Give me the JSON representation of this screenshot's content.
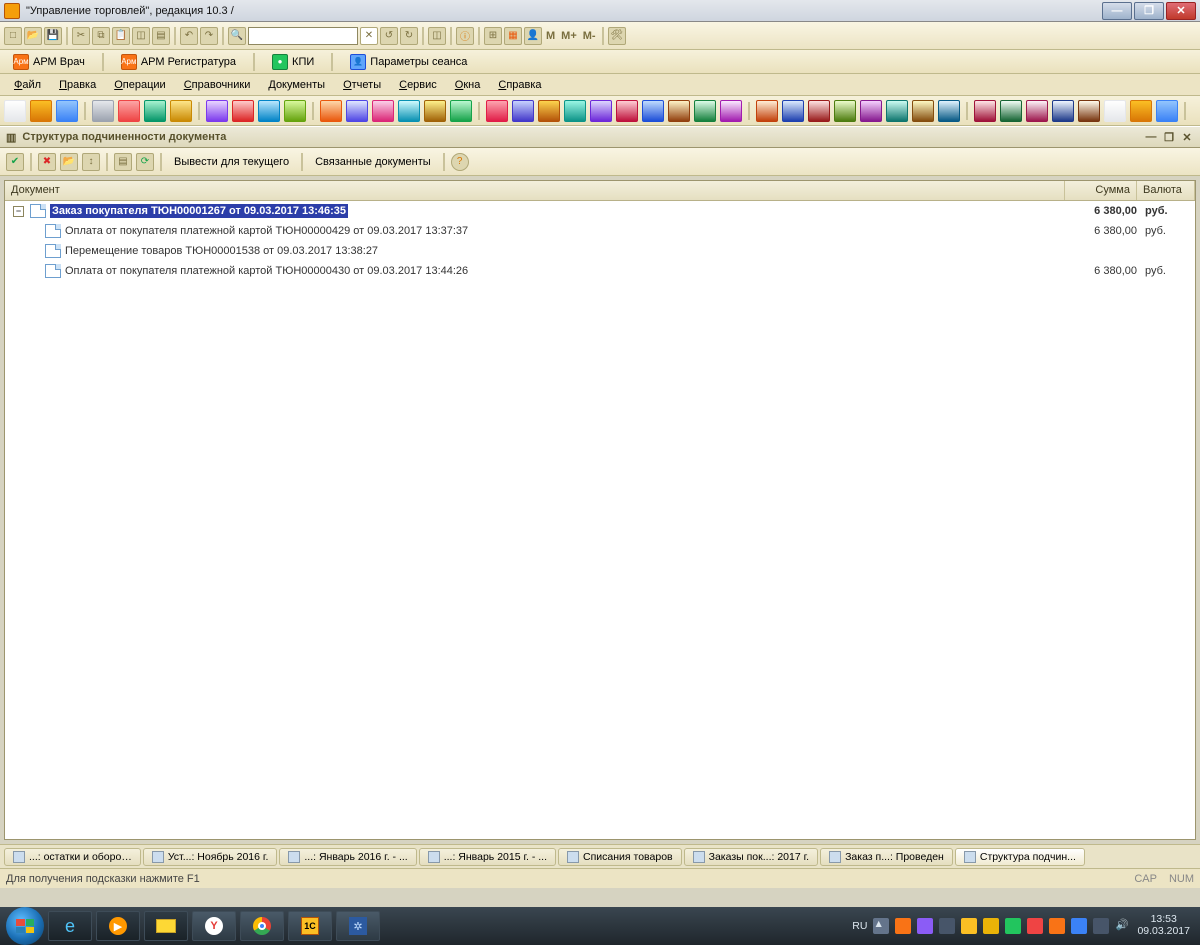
{
  "title": "\"Управление торговлей\", редакция 10.3 /",
  "arm": {
    "doctor": "АРМ Врач",
    "reg": "АРМ Регистратура",
    "kpi": "КПИ",
    "params": "Параметры сеанса"
  },
  "memory": {
    "m": "M",
    "mplus": "M+",
    "mminus": "M-"
  },
  "menu": [
    "Файл",
    "Правка",
    "Операции",
    "Справочники",
    "Документы",
    "Отчеты",
    "Сервис",
    "Окна",
    "Справка"
  ],
  "panel": {
    "title": "Структура подчиненности документа",
    "toolbar": {
      "output_current": "Вывести для текущего",
      "related": "Связанные документы"
    },
    "columns": {
      "doc": "Документ",
      "sum": "Сумма",
      "currency": "Валюта"
    },
    "rows": [
      {
        "indent": 0,
        "selected": true,
        "text": "Заказ покупателя ТЮН00001267 от 09.03.2017 13:46:35",
        "sum": "6 380,00",
        "currency": "руб."
      },
      {
        "indent": 1,
        "selected": false,
        "text": "Оплата от покупателя платежной картой ТЮН00000429 от 09.03.2017 13:37:37",
        "sum": "6 380,00",
        "currency": "руб."
      },
      {
        "indent": 1,
        "selected": false,
        "text": "Перемещение товаров ТЮН00001538 от 09.03.2017 13:38:27",
        "sum": "",
        "currency": ""
      },
      {
        "indent": 1,
        "selected": false,
        "text": "Оплата от покупателя платежной картой ТЮН00000430 от 09.03.2017 13:44:26",
        "sum": "6 380,00",
        "currency": "руб."
      }
    ]
  },
  "mdi_tabs": [
    "...: остатки и оборо…",
    "Уст...: Ноябрь 2016 г.",
    "...: Январь 2016 г. - ...",
    "...: Январь 2015 г. - ...",
    "Списания товаров",
    "Заказы пок...: 2017 г.",
    "Заказ п...: Проведен",
    "Структура подчин..."
  ],
  "statusbar": {
    "hint": "Для получения подсказки нажмите F1",
    "cap": "CAP",
    "num": "NUM"
  },
  "taskbar": {
    "lang": "RU",
    "time": "13:53",
    "date": "09.03.2017"
  },
  "icon_colors": [
    [
      "#fff",
      "#e5e7eb"
    ],
    [
      "#fbbf24",
      "#d97706"
    ],
    [
      "#93c5fd",
      "#3b82f6"
    ],
    [
      "#e5e7eb",
      "#9ca3af"
    ],
    [
      "#fca5a5",
      "#ef4444"
    ],
    [
      "#a7f3d0",
      "#059669"
    ],
    [
      "#fde68a",
      "#ca8a04"
    ],
    [
      "#e9d5ff",
      "#7c3aed"
    ],
    [
      "#fecaca",
      "#dc2626"
    ],
    [
      "#bae6fd",
      "#0284c7"
    ],
    [
      "#d9f99d",
      "#65a30d"
    ],
    [
      "#fed7aa",
      "#ea580c"
    ],
    [
      "#e0e7ff",
      "#4f46e5"
    ],
    [
      "#fbcfe8",
      "#db2777"
    ],
    [
      "#cffafe",
      "#0891b2"
    ],
    [
      "#fef08a",
      "#a16207"
    ],
    [
      "#bbf7d0",
      "#16a34a"
    ],
    [
      "#fda4af",
      "#e11d48"
    ],
    [
      "#c7d2fe",
      "#4338ca"
    ],
    [
      "#fcd34d",
      "#b45309"
    ],
    [
      "#99f6e4",
      "#0d9488"
    ],
    [
      "#ddd6fe",
      "#6d28d9"
    ],
    [
      "#fecdd3",
      "#be123c"
    ],
    [
      "#bfdbfe",
      "#1d4ed8"
    ],
    [
      "#fef3c7",
      "#92400e"
    ],
    [
      "#dcfce7",
      "#15803d"
    ],
    [
      "#fae8ff",
      "#a21caf"
    ],
    [
      "#ffedd5",
      "#c2410c"
    ],
    [
      "#dbeafe",
      "#1e40af"
    ],
    [
      "#fee2e2",
      "#991b1b"
    ],
    [
      "#ecfccb",
      "#4d7c0f"
    ],
    [
      "#f5d0fe",
      "#86198f"
    ],
    [
      "#ccfbf1",
      "#0f766e"
    ],
    [
      "#fef9c3",
      "#854d0e"
    ],
    [
      "#e0f2fe",
      "#075985"
    ],
    [
      "#ffe4e6",
      "#9f1239"
    ],
    [
      "#f0fdf4",
      "#166534"
    ],
    [
      "#fdf2f8",
      "#9d174d"
    ],
    [
      "#eff6ff",
      "#1e3a8a"
    ],
    [
      "#fffbeb",
      "#78350f"
    ]
  ]
}
